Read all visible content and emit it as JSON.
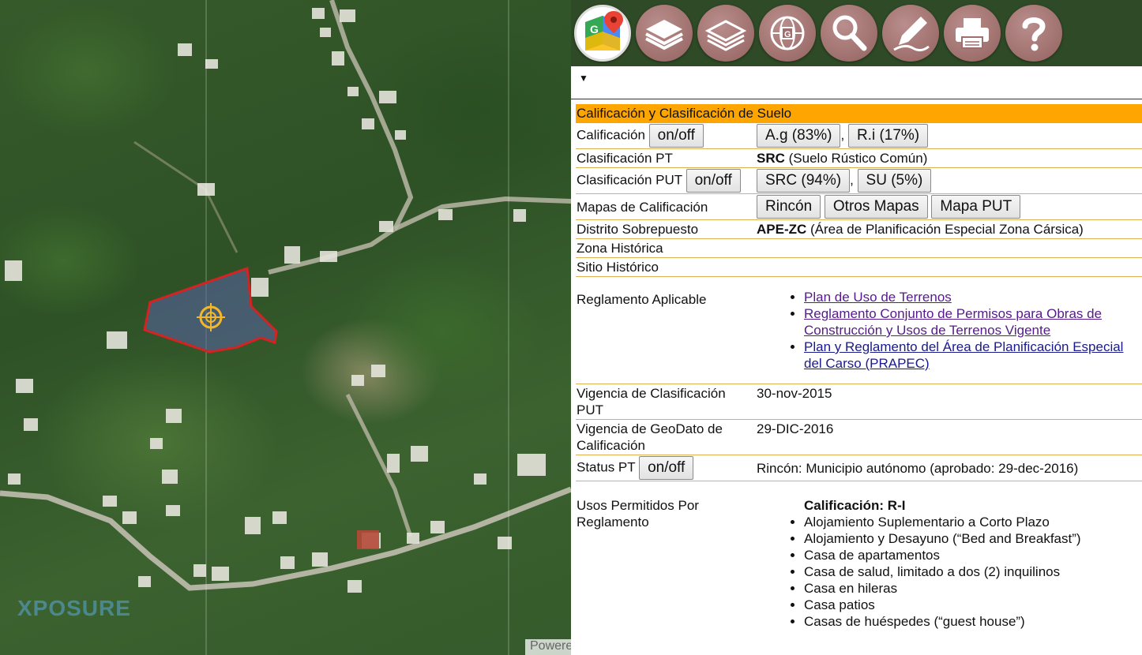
{
  "map": {
    "watermark": "XPOSURE",
    "powered_text": "Powered by"
  },
  "toolbar": {
    "icons": [
      "google-maps-icon",
      "layers-icon",
      "layers-alt-icon",
      "globe-icon",
      "search-icon",
      "edit-icon",
      "print-icon",
      "help-icon"
    ]
  },
  "panel": {
    "caret": "▼",
    "section_title": "Calificación y Clasificación de Suelo",
    "rows": {
      "calificacion": {
        "label": "Calificación",
        "toggle": "on/off",
        "values": [
          "A.g (83%)",
          "R.i (17%)"
        ]
      },
      "clasificacion_pt": {
        "label": "Clasificación PT",
        "code": "SRC",
        "desc": "(Suelo Rústico Común)"
      },
      "clasificacion_put": {
        "label": "Clasificación PUT",
        "toggle": "on/off",
        "values": [
          "SRC (94%)",
          "SU (5%)"
        ]
      },
      "mapas": {
        "label": "Mapas de Calificación",
        "buttons": [
          "Rincón",
          "Otros Mapas",
          "Mapa PUT"
        ]
      },
      "distrito": {
        "label": "Distrito Sobrepuesto",
        "code": "APE-ZC",
        "desc": "(Área de Planificación Especial Zona Cársica)"
      },
      "zona_historica": {
        "label": "Zona Histórica"
      },
      "sitio_historico": {
        "label": "Sitio Histórico"
      },
      "reglamento": {
        "label": "Reglamento Aplicable",
        "links": [
          "Plan de Uso de Terrenos",
          "Reglamento Conjunto de Permisos para Obras de Construcción y Usos de Terrenos Vigente",
          "Plan y Reglamento del Área de Planificación Especial del Carso (PRAPEC)"
        ]
      },
      "vigencia_put": {
        "label": "Vigencia de Clasificación PUT",
        "value": "30-nov-2015"
      },
      "vigencia_geodato": {
        "label": "Vigencia de GeoDato de Calificación",
        "value": "29-DIC-2016"
      },
      "status_pt": {
        "label": "Status PT",
        "toggle": "on/off",
        "value": "Rincón: Municipio autónomo (aprobado: 29-dec-2016)"
      },
      "usos": {
        "label": "Usos Permitidos Por Reglamento",
        "heading": "Calificación: R-I",
        "items": [
          "Alojamiento Suplementario a Corto Plazo",
          "Alojamiento y Desayuno (“Bed and Breakfast”)",
          "Casa de apartamentos",
          "Casa de salud, limitado a dos (2) inquilinos",
          "Casa en hileras",
          "Casa patios",
          "Casas de huéspedes (“guest house”)"
        ]
      }
    }
  }
}
